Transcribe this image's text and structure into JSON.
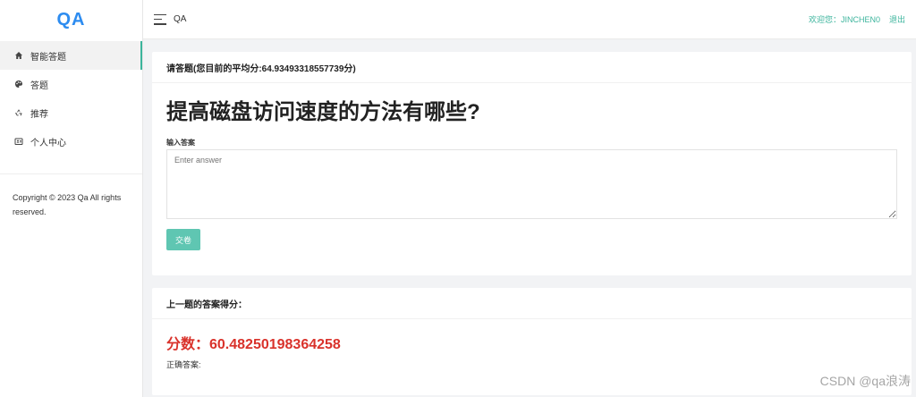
{
  "brand": "QA",
  "nav": [
    {
      "label": "智能答题",
      "icon": "home-icon",
      "active": true
    },
    {
      "label": "答题",
      "icon": "palette-icon",
      "active": false
    },
    {
      "label": "推荐",
      "icon": "recycle-icon",
      "active": false
    },
    {
      "label": "个人中心",
      "icon": "id-card-icon",
      "active": false
    }
  ],
  "copyright": "Copyright © 2023 Qa All rights reserved.",
  "topbar": {
    "title": "QA",
    "welcome": "欢迎您：JINCHEN0",
    "logout": "退出"
  },
  "quiz": {
    "header": "请答题(您目前的平均分:64.93493318557739分)",
    "question": "提高磁盘访问速度的方法有哪些?",
    "answer_label": "输入答案",
    "answer_placeholder": "Enter answer",
    "submit_label": "交卷"
  },
  "result": {
    "header": "上一题的答案得分：",
    "score_text": "分数：60.48250198364258",
    "correct_label": "正确答案:"
  },
  "watermark": "CSDN @qa浪涛",
  "colors": {
    "brand": "#2d8cf0",
    "accent": "#3bb49c",
    "button": "#5fc6b2",
    "score": "#d9322b"
  }
}
